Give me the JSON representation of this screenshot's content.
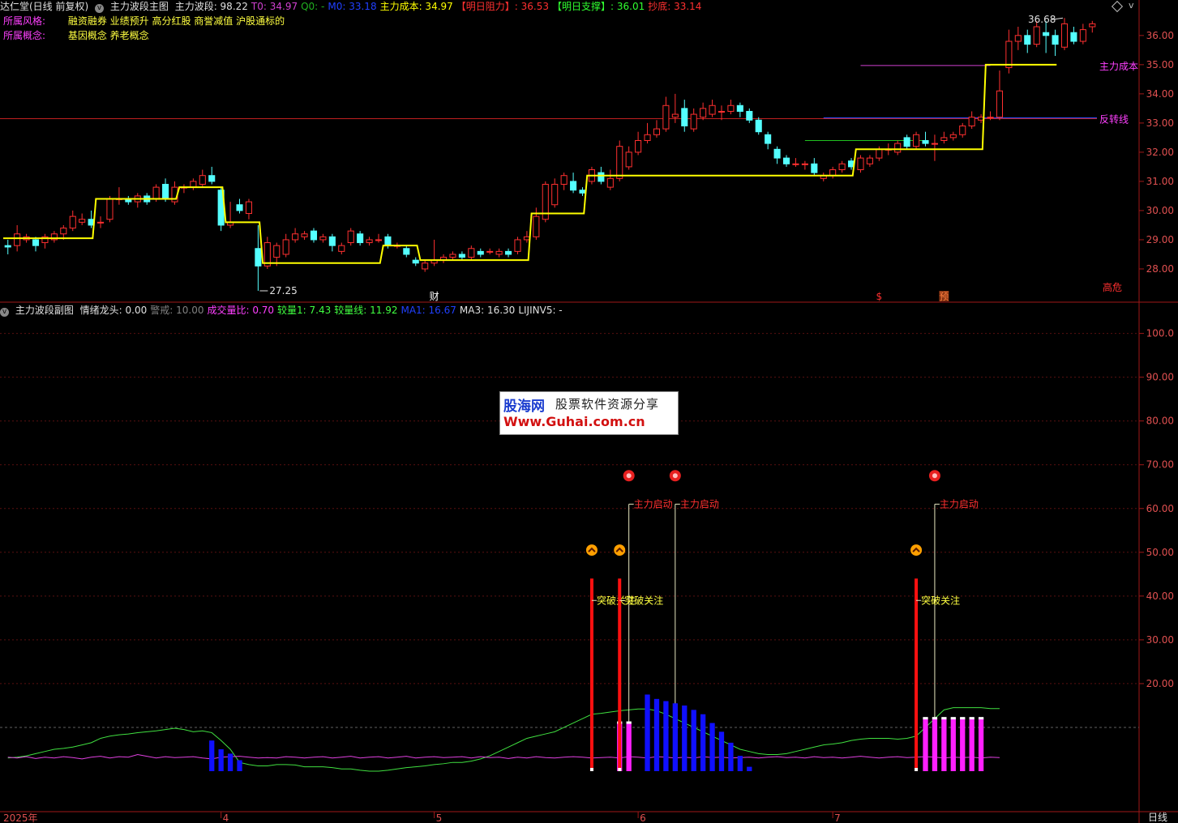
{
  "header": {
    "stock_name": "达仁堂(日线 前复权)",
    "main_indicator": "主力波段主图",
    "items": [
      {
        "label": "主力波段",
        "value": "98.22",
        "color": "#e0e0e0"
      },
      {
        "label": "T0",
        "value": "34.97",
        "color": "#d040d0"
      },
      {
        "label": "Q0",
        "value": "-",
        "color": "#20b020"
      },
      {
        "label": "M0",
        "value": "33.18",
        "color": "#2040ff"
      },
      {
        "label": "主力成本",
        "value": "34.97",
        "color": "#ffff00"
      },
      {
        "label": "【明日阻力】",
        "value": "36.53",
        "color": "#ff3030"
      },
      {
        "label": "【明日支撑】",
        "value": "36.01",
        "color": "#30ff30"
      },
      {
        "label": "抄底",
        "value": "33.14",
        "color": "#ff3030"
      }
    ],
    "style_label": "所属风格:",
    "style_value": "融资融券 业绩预升 高分红股 商誉减值 沪股通标的",
    "concept_label": "所属概念:",
    "concept_value": "基因概念 养老概念",
    "corner_icons": [
      "diamond-icon",
      "chevron-down-icon"
    ]
  },
  "sub_header": {
    "title": "主力波段副图",
    "items": [
      {
        "label": "情绪龙头",
        "value": "0.00",
        "color": "#e0e0e0"
      },
      {
        "label": "警戒",
        "value": "10.00",
        "color": "#808080"
      },
      {
        "label": "成交量比",
        "value": "0.70",
        "color": "#ff40ff"
      },
      {
        "label": "较量1",
        "value": "7.43",
        "color": "#40ff40"
      },
      {
        "label": "较量线",
        "value": "11.92",
        "color": "#40ff40"
      },
      {
        "label": "MA1",
        "value": "16.67",
        "color": "#2040ff"
      },
      {
        "label": "MA3",
        "value": "16.30",
        "color": "#e0e0e0"
      },
      {
        "label": "LIJINV5",
        "value": "-",
        "color": "#e0e0e0"
      }
    ]
  },
  "watermark": {
    "brand": "股海网",
    "slogan": "股票软件资源分享",
    "url": "Www.Guhai.com.cn"
  },
  "corner_label": "日线",
  "chart_data": [
    {
      "type": "candlestick",
      "ylim": [
        27.0,
        36.8
      ],
      "y_ticks": [
        "36.00",
        "35.00",
        "34.00",
        "33.00",
        "32.00",
        "31.00",
        "30.00",
        "29.00",
        "28.00"
      ],
      "candles": [
        [
          28.8,
          28.75,
          29.0,
          28.5
        ],
        [
          28.8,
          29.2,
          29.5,
          28.6
        ],
        [
          29.0,
          29.1,
          29.2,
          28.9
        ],
        [
          29.0,
          28.8,
          29.1,
          28.6
        ],
        [
          28.9,
          29.1,
          29.2,
          28.7
        ],
        [
          29.0,
          29.2,
          29.3,
          28.9
        ],
        [
          29.2,
          29.4,
          29.5,
          29.0
        ],
        [
          29.4,
          29.8,
          30.0,
          29.3
        ],
        [
          29.6,
          29.7,
          29.9,
          29.5
        ],
        [
          29.7,
          29.5,
          30.0,
          29.4
        ],
        [
          29.6,
          29.6,
          29.8,
          29.4
        ],
        [
          29.7,
          30.4,
          30.5,
          29.6
        ],
        [
          30.4,
          30.4,
          30.8,
          30.2
        ],
        [
          30.4,
          30.3,
          30.5,
          30.2
        ],
        [
          30.3,
          30.5,
          30.6,
          30.1
        ],
        [
          30.5,
          30.3,
          30.6,
          30.2
        ],
        [
          30.4,
          30.8,
          30.9,
          30.3
        ],
        [
          30.9,
          30.4,
          31.1,
          30.3
        ],
        [
          30.3,
          30.8,
          31.0,
          30.2
        ],
        [
          30.8,
          30.8,
          30.9,
          30.6
        ],
        [
          30.8,
          31.0,
          31.1,
          30.7
        ],
        [
          30.9,
          31.2,
          31.4,
          30.8
        ],
        [
          31.2,
          31.0,
          31.5,
          30.9
        ],
        [
          30.7,
          29.5,
          30.8,
          29.3
        ],
        [
          29.5,
          29.6,
          30.3,
          29.4
        ],
        [
          30.2,
          30.0,
          30.4,
          29.9
        ],
        [
          29.9,
          30.3,
          30.4,
          29.7
        ],
        [
          28.7,
          28.1,
          29.5,
          27.25
        ],
        [
          28.1,
          28.9,
          29.1,
          28.0
        ],
        [
          28.4,
          28.8,
          28.9,
          28.1
        ],
        [
          28.5,
          29.0,
          29.2,
          28.4
        ],
        [
          29.0,
          29.2,
          29.4,
          28.9
        ],
        [
          29.1,
          29.2,
          29.3,
          29.0
        ],
        [
          29.3,
          29.0,
          29.4,
          28.9
        ],
        [
          29.0,
          29.1,
          29.2,
          28.9
        ],
        [
          29.1,
          28.8,
          29.2,
          28.6
        ],
        [
          28.6,
          28.8,
          28.9,
          28.5
        ],
        [
          28.9,
          29.3,
          29.4,
          28.8
        ],
        [
          29.2,
          28.9,
          29.3,
          28.8
        ],
        [
          28.9,
          29.0,
          29.1,
          28.8
        ],
        [
          29.0,
          29.0,
          29.2,
          28.9
        ],
        [
          29.1,
          28.8,
          29.2,
          28.7
        ],
        [
          28.8,
          28.8,
          28.9,
          28.7
        ],
        [
          28.7,
          28.5,
          28.8,
          28.4
        ],
        [
          28.3,
          28.2,
          28.4,
          28.1
        ],
        [
          28.0,
          28.2,
          28.3,
          27.9
        ],
        [
          28.2,
          28.3,
          29.0,
          28.1
        ],
        [
          28.3,
          28.4,
          28.5,
          28.2
        ],
        [
          28.4,
          28.5,
          28.6,
          28.3
        ],
        [
          28.5,
          28.4,
          28.6,
          28.3
        ],
        [
          28.4,
          28.7,
          28.8,
          28.3
        ],
        [
          28.6,
          28.5,
          28.7,
          28.4
        ],
        [
          28.6,
          28.6,
          28.7,
          28.5
        ],
        [
          28.5,
          28.6,
          28.7,
          28.4
        ],
        [
          28.6,
          28.5,
          28.7,
          28.4
        ],
        [
          28.6,
          29.0,
          29.1,
          28.5
        ],
        [
          29.0,
          29.1,
          29.3,
          28.9
        ],
        [
          29.1,
          29.8,
          30.1,
          29.0
        ],
        [
          29.7,
          30.9,
          31.0,
          29.6
        ],
        [
          30.2,
          30.9,
          31.1,
          30.1
        ],
        [
          30.9,
          31.2,
          31.3,
          30.7
        ],
        [
          31.0,
          30.7,
          31.3,
          30.6
        ],
        [
          30.7,
          30.6,
          30.8,
          30.5
        ],
        [
          31.0,
          31.4,
          31.5,
          30.9
        ],
        [
          31.3,
          31.0,
          31.5,
          30.9
        ],
        [
          30.8,
          31.1,
          31.4,
          30.7
        ],
        [
          31.1,
          32.2,
          32.4,
          31.0
        ],
        [
          31.5,
          32.0,
          32.2,
          31.4
        ],
        [
          32.0,
          32.4,
          32.7,
          31.9
        ],
        [
          32.4,
          32.6,
          33.0,
          32.3
        ],
        [
          32.6,
          32.8,
          33.1,
          32.5
        ],
        [
          32.8,
          33.6,
          33.9,
          32.7
        ],
        [
          33.2,
          33.3,
          34.0,
          33.0
        ],
        [
          33.5,
          32.9,
          33.8,
          32.7
        ],
        [
          32.8,
          33.3,
          33.5,
          32.7
        ],
        [
          33.2,
          33.5,
          33.7,
          33.1
        ],
        [
          33.3,
          33.6,
          33.8,
          33.2
        ],
        [
          33.4,
          33.4,
          33.6,
          33.1
        ],
        [
          33.4,
          33.6,
          33.8,
          33.3
        ],
        [
          33.6,
          33.4,
          33.7,
          33.2
        ],
        [
          33.4,
          33.1,
          33.5,
          33.0
        ],
        [
          33.1,
          32.7,
          33.2,
          32.6
        ],
        [
          32.6,
          32.3,
          32.7,
          32.1
        ],
        [
          32.1,
          31.8,
          32.2,
          31.6
        ],
        [
          31.8,
          31.6,
          31.9,
          31.5
        ],
        [
          31.6,
          31.6,
          31.8,
          31.5
        ],
        [
          31.6,
          31.6,
          31.7,
          31.4
        ],
        [
          31.6,
          31.3,
          31.8,
          31.2
        ],
        [
          31.1,
          31.2,
          31.3,
          31.0
        ],
        [
          31.2,
          31.4,
          31.5,
          31.1
        ],
        [
          31.4,
          31.6,
          31.7,
          31.3
        ],
        [
          31.7,
          31.5,
          31.8,
          31.4
        ],
        [
          31.4,
          31.8,
          31.9,
          31.3
        ],
        [
          31.6,
          31.8,
          31.9,
          31.5
        ],
        [
          31.8,
          32.1,
          32.2,
          31.7
        ],
        [
          32.1,
          32.1,
          32.3,
          31.9
        ],
        [
          32.0,
          32.3,
          32.4,
          31.9
        ],
        [
          32.5,
          32.2,
          32.6,
          32.1
        ],
        [
          32.2,
          32.6,
          32.7,
          32.1
        ],
        [
          32.4,
          32.3,
          32.7,
          32.2
        ],
        [
          32.3,
          32.3,
          32.6,
          31.7
        ],
        [
          32.4,
          32.5,
          32.7,
          32.3
        ],
        [
          32.5,
          32.6,
          32.7,
          32.4
        ],
        [
          32.6,
          32.9,
          33.0,
          32.5
        ],
        [
          32.9,
          33.2,
          33.4,
          32.8
        ],
        [
          33.1,
          33.2,
          33.3,
          33.0
        ],
        [
          33.2,
          33.2,
          33.4,
          33.1
        ],
        [
          33.2,
          34.1,
          34.8,
          33.1
        ],
        [
          34.9,
          35.8,
          36.2,
          34.7
        ],
        [
          35.8,
          36.0,
          36.3,
          35.5
        ],
        [
          36.0,
          35.7,
          36.2,
          35.4
        ],
        [
          35.7,
          36.3,
          36.5,
          35.6
        ],
        [
          36.1,
          36.0,
          36.5,
          35.4
        ],
        [
          36.0,
          35.7,
          36.2,
          35.3
        ],
        [
          35.6,
          36.4,
          36.6,
          35.5
        ],
        [
          36.1,
          35.8,
          36.3,
          35.7
        ],
        [
          35.8,
          36.2,
          36.4,
          35.7
        ],
        [
          36.3,
          36.4,
          36.5,
          36.1
        ]
      ],
      "main_cost_line_level": 34.97,
      "reversal_line_level": 33.15,
      "cost_label": "主力成本",
      "reversal_label": "反转线",
      "high_label": "36.68",
      "low_label": "27.25",
      "event_labels": [
        "财",
        "$",
        "预",
        "高危"
      ],
      "band_steps": [
        {
          "from": 0,
          "to": 9,
          "value": 29.05
        },
        {
          "from": 10,
          "to": 10,
          "value": 30.4
        },
        {
          "from": 11,
          "to": 18,
          "value": 30.4
        },
        {
          "from": 19,
          "to": 23,
          "value": 30.8
        },
        {
          "from": 24,
          "to": 27,
          "value": 29.6
        },
        {
          "from": 28,
          "to": 40,
          "value": 28.2
        },
        {
          "from": 41,
          "to": 44,
          "value": 28.8
        },
        {
          "from": 45,
          "to": 56,
          "value": 28.3
        },
        {
          "from": 57,
          "to": 62,
          "value": 29.9
        },
        {
          "from": 63,
          "to": 91,
          "value": 31.2
        },
        {
          "from": 92,
          "to": 105,
          "value": 32.1
        },
        {
          "from": 106,
          "to": 113,
          "value": 35.0
        }
      ]
    },
    {
      "type": "bar",
      "ylim": [
        0,
        104
      ],
      "y_ticks": [
        "100.0",
        "90.00",
        "80.00",
        "70.00",
        "60.00",
        "50.00",
        "40.00",
        "30.00",
        "20.00"
      ],
      "x_ticks": [
        "2025年",
        "4",
        "5",
        "6",
        "7"
      ],
      "blue_bars": [
        {
          "i": 22,
          "v": 7
        },
        {
          "i": 23,
          "v": 5
        },
        {
          "i": 24,
          "v": 4
        },
        {
          "i": 25,
          "v": 2.5
        },
        {
          "i": 69,
          "v": 17.5
        },
        {
          "i": 70,
          "v": 16.5
        },
        {
          "i": 71,
          "v": 16
        },
        {
          "i": 72,
          "v": 15.5
        },
        {
          "i": 73,
          "v": 15
        },
        {
          "i": 74,
          "v": 14
        },
        {
          "i": 75,
          "v": 13
        },
        {
          "i": 76,
          "v": 11
        },
        {
          "i": 77,
          "v": 9
        },
        {
          "i": 78,
          "v": 6.5
        },
        {
          "i": 79,
          "v": 3.5
        },
        {
          "i": 80,
          "v": 1
        }
      ],
      "magenta_bars": [
        {
          "i": 66,
          "v": 11
        },
        {
          "i": 67,
          "v": 11
        },
        {
          "i": 99,
          "v": 12
        },
        {
          "i": 100,
          "v": 12
        },
        {
          "i": 101,
          "v": 12
        },
        {
          "i": 102,
          "v": 12
        },
        {
          "i": 103,
          "v": 12
        },
        {
          "i": 104,
          "v": 12
        },
        {
          "i": 105,
          "v": 12
        }
      ],
      "red_spikes": [
        {
          "i": 63,
          "v": 44
        },
        {
          "i": 66,
          "v": 44
        },
        {
          "i": 98,
          "v": 44
        }
      ],
      "thin_lines": [
        {
          "i": 67,
          "v": 61
        },
        {
          "i": 72,
          "v": 61
        },
        {
          "i": 100,
          "v": 61
        }
      ],
      "breakout_text": "突破关注",
      "start_text": "主力启动",
      "icon_up_positions": [
        63,
        66,
        98
      ],
      "icon_coin_positions": [
        67,
        72,
        100
      ],
      "alert_level": 10,
      "green_line": [
        1,
        1.2,
        1.5,
        2,
        2.5,
        3,
        3.2,
        3.5,
        4,
        4.5,
        5.5,
        6,
        6.3,
        6.5,
        6.8,
        7,
        7.2,
        7.5,
        7.8,
        7.5,
        7,
        7.2,
        6.8,
        5,
        3,
        0,
        -0.5,
        -0.8,
        -0.8,
        -0.5,
        -0.5,
        -0.6,
        -1,
        -1,
        -1,
        -1.2,
        -1.5,
        -1.5,
        -1.8,
        -2,
        -2,
        -1.8,
        -1.5,
        -1.2,
        -1,
        -0.8,
        -0.5,
        -0.3,
        0,
        0,
        0.3,
        0.8,
        1.5,
        2.5,
        3.5,
        4.5,
        5.5,
        6,
        6.5,
        7,
        8,
        9,
        10,
        11,
        11.2,
        11.5,
        11.8,
        12,
        12.2,
        12.2,
        11.8,
        11,
        10,
        9,
        8,
        7,
        6,
        5,
        4,
        3,
        2.5,
        2,
        1.8,
        1.8,
        2,
        2.5,
        3,
        3.5,
        4,
        4.2,
        4.5,
        5,
        5.3,
        5.5,
        5.5,
        5.5,
        5.3,
        5.5,
        6,
        8,
        10,
        12,
        12.5,
        12.5,
        12.5,
        12.5,
        12.3,
        12.3
      ],
      "magenta_line": [
        1.2,
        1.0,
        1.3,
        0.9,
        1.2,
        1.0,
        1.3,
        1.1,
        0.8,
        1.2,
        1.4,
        1.0,
        1.3,
        1.2,
        1.8,
        1.4,
        1.0,
        1.3,
        1.1,
        1.2,
        1.3,
        1.0,
        0.8,
        1.2,
        1.3,
        1.4,
        1.2,
        1.0,
        1.1,
        1.0,
        1.3,
        1.2,
        1.0,
        1.2,
        1.3,
        1.0,
        1.2,
        1.4,
        1.0,
        1.2,
        1.3,
        1.0,
        1.2,
        1.4,
        1.0,
        1.2,
        1.3,
        1.1,
        1.2,
        1.3,
        1.0,
        1.3,
        1.1,
        1.2,
        0.9,
        1.2,
        1.0,
        1.3,
        1.1,
        1.0,
        1.2,
        1.3,
        1.2,
        1.0,
        1.1,
        1.2,
        1.0,
        1.3,
        1.2,
        1.0,
        1.3,
        1.2,
        1.0,
        1.2,
        1.0,
        1.3,
        1.1,
        1.2,
        1.0,
        1.1,
        1.2,
        1.0,
        1.2,
        1.3,
        1.1,
        1.2,
        1.0,
        1.3,
        1.1,
        1.2,
        1.0,
        1.2,
        1.4,
        1.2,
        1.0,
        1.2,
        1.3,
        1.1,
        1.2,
        1.3,
        1.2,
        1.0,
        1.2,
        1.1,
        1.2,
        1.0,
        1.2,
        1.1
      ]
    }
  ]
}
